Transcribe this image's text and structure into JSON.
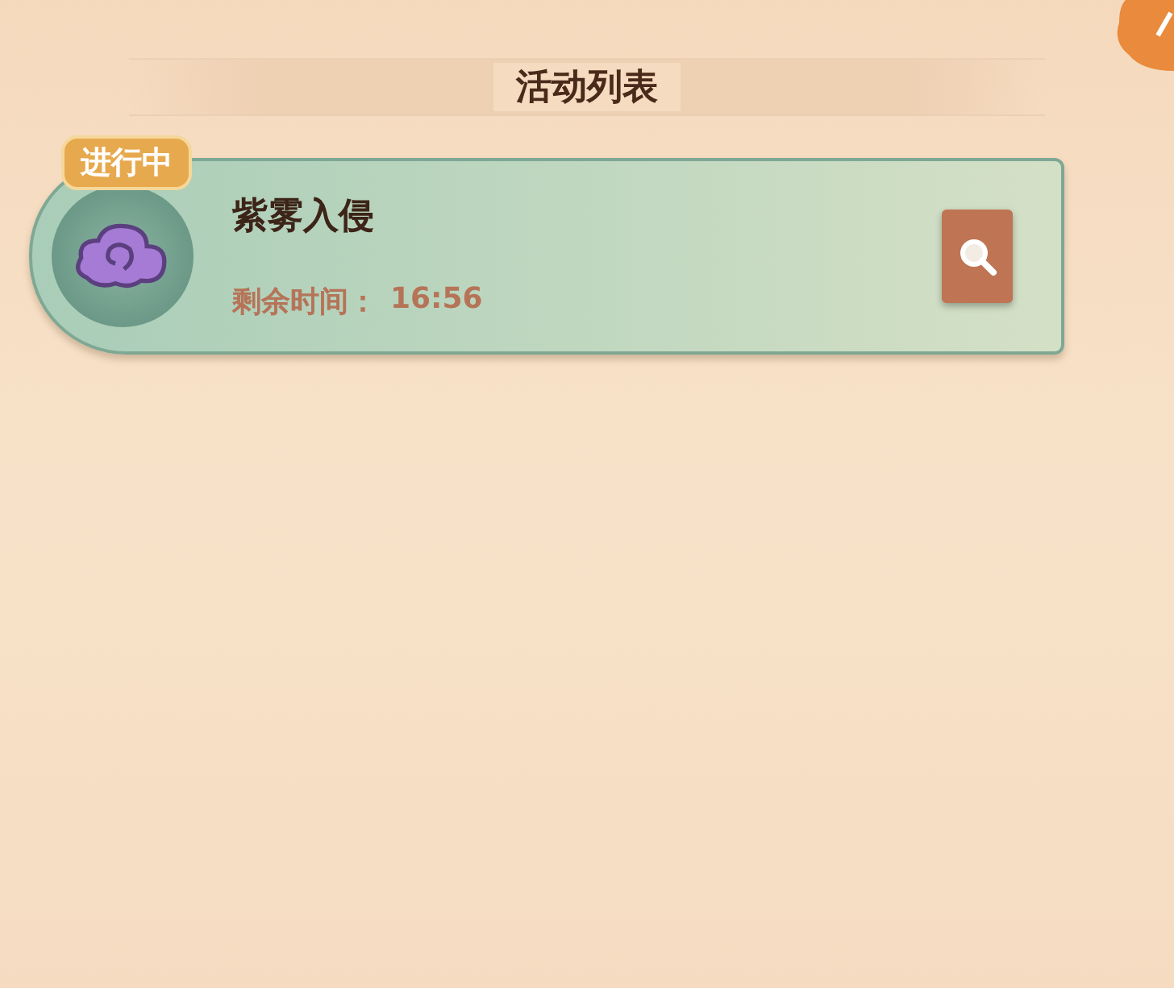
{
  "title": "活动列表",
  "events": [
    {
      "status": "进行中",
      "name": "紫雾入侵",
      "time_label": "剩余时间：",
      "time_value": "16:56"
    }
  ]
}
